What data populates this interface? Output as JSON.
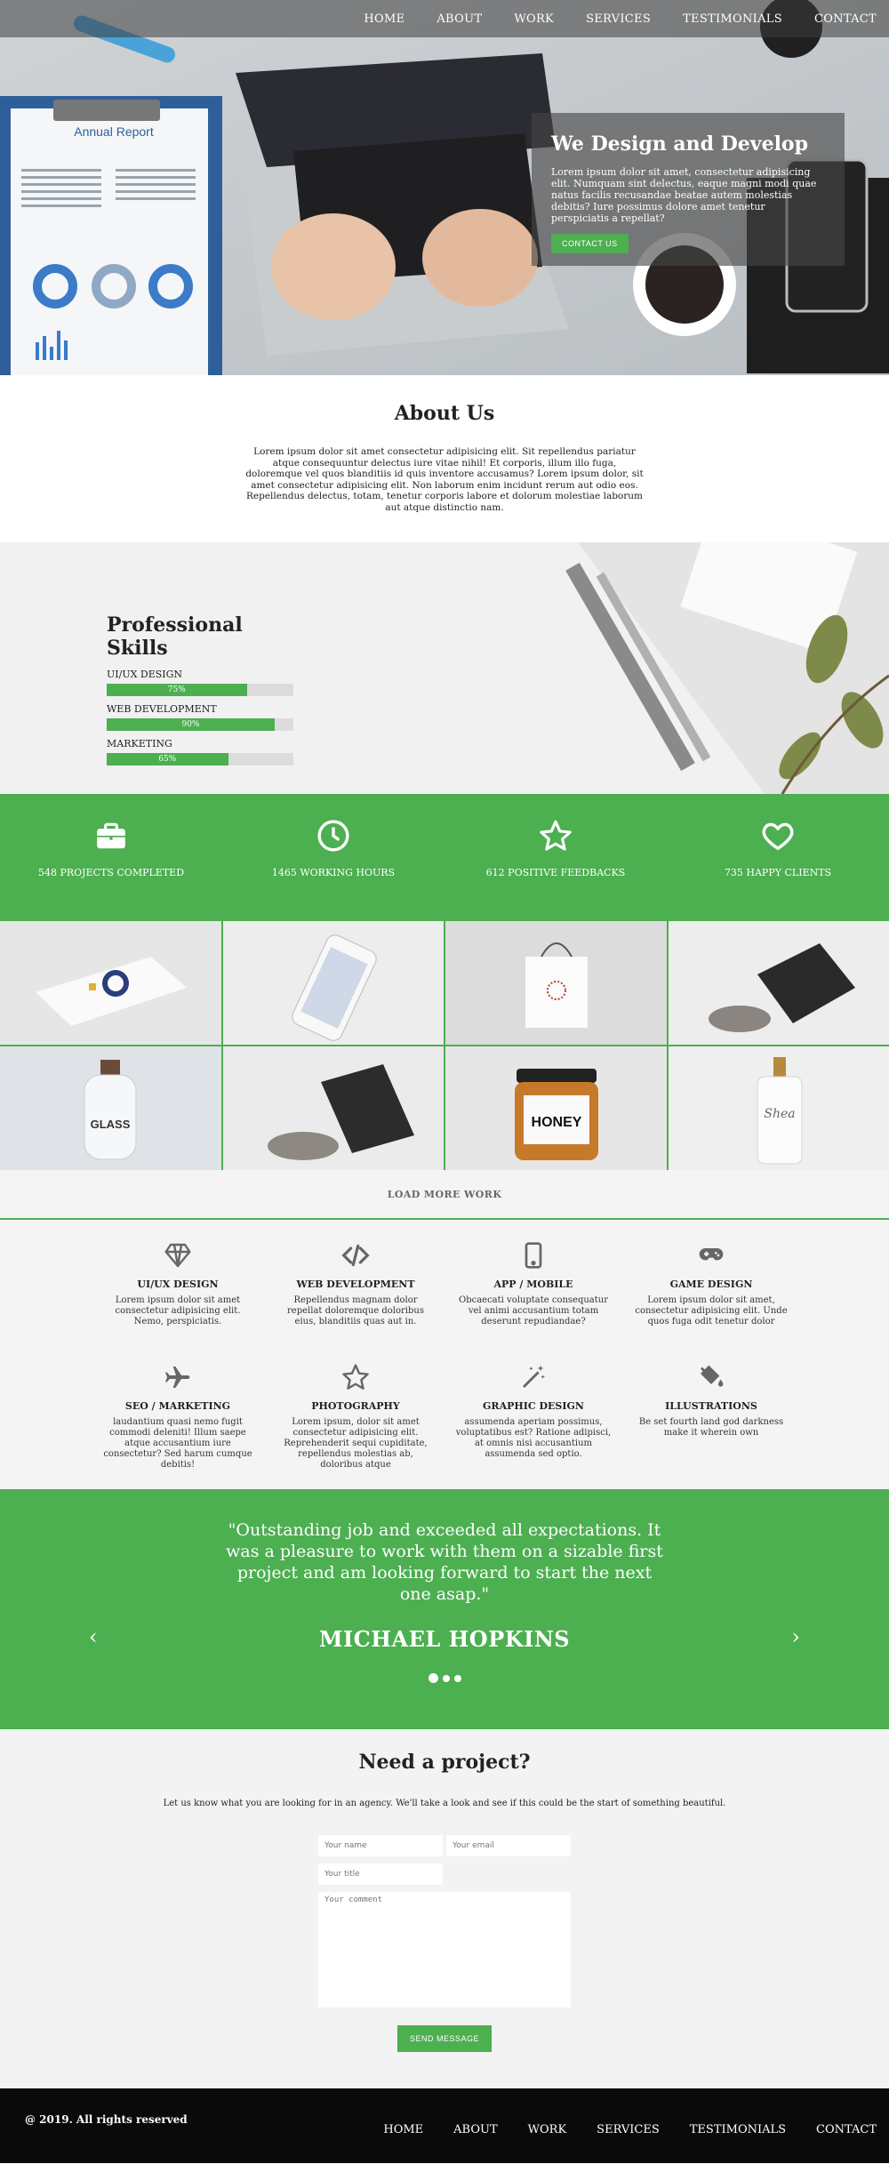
{
  "nav": {
    "items": [
      "HOME",
      "ABOUT",
      "WORK",
      "SERVICES",
      "TESTIMONIALS",
      "CONTACT"
    ]
  },
  "hero": {
    "title": "We Design and Develop",
    "text": "Lorem ipsum dolor sit amet, consectetur adipisicing elit. Numquam sint delectus, eaque magni modi quae natus facilis recusandae beatae autem molestias debitis? Iure possimus dolore amet tenetur perspiciatis a repellat?",
    "button": "CONTACT US",
    "report_title": "Annual Report"
  },
  "about": {
    "title": "About Us",
    "text": "Lorem ipsum dolor sit amet consectetur adipisicing elit. Sit repellendus pariatur atque consequuntur delectus iure vitae nihil! Et corporis, illum illo fuga, doloremque vel quos blanditiis id quis inventore accusamus? Lorem ipsum dolor, sit amet consectetur adipisicing elit. Non laborum enim incidunt rerum aut odio eos. Repellendus delectus, totam, tenetur corporis labore et dolorum molestiae laborum aut atque distinctio nam."
  },
  "skills": {
    "title": "Professional Skills",
    "items": [
      {
        "label": "UI/UX DESIGN",
        "value": 75,
        "text": "75%"
      },
      {
        "label": "WEB DEVELOPMENT",
        "value": 90,
        "text": "90%"
      },
      {
        "label": "MARKETING",
        "value": 65,
        "text": "65%"
      }
    ]
  },
  "stats": [
    {
      "icon": "briefcase-icon",
      "text": "548 PROJECTS COMPLETED"
    },
    {
      "icon": "clock-icon",
      "text": "1465 WORKING HOURS"
    },
    {
      "icon": "star-icon",
      "text": "612 POSITIVE FEEDBACKS"
    },
    {
      "icon": "heart-icon",
      "text": "735 HAPPY CLIENTS"
    }
  ],
  "portfolio": {
    "tiles": [
      {
        "name": "business-card-mockup",
        "bg": "#e4e4e4"
      },
      {
        "name": "phone-mockup",
        "bg": "#ececec"
      },
      {
        "name": "shopping-bag-mockup",
        "bg": "#dedede"
      },
      {
        "name": "dark-book-mockup",
        "bg": "#eeeeee"
      },
      {
        "name": "glass-bottle-mockup",
        "bg": "#dfe3e8",
        "label": "GLASS"
      },
      {
        "name": "dark-card-with-stone-mockup",
        "bg": "#ebebeb"
      },
      {
        "name": "honey-jar-mockup",
        "bg": "#e6e6e6",
        "label": "HONEY"
      },
      {
        "name": "soap-bottle-mockup",
        "bg": "#efefef",
        "label": "Shea"
      }
    ],
    "load_more": "LOAD MORE WORK"
  },
  "services": [
    {
      "icon": "diamond-icon",
      "title": "UI/UX DESIGN",
      "text": "Lorem ipsum dolor sit amet consectetur adipisicing elit. Nemo, perspiciatis."
    },
    {
      "icon": "code-icon",
      "title": "WEB DEVELOPMENT",
      "text": "Repellendus magnam dolor repellat doloremque doloribus eius, blanditiis quas aut in."
    },
    {
      "icon": "mobile-icon",
      "title": "APP / MOBILE",
      "text": "Obcaecati voluptate consequatur vel animi accusantium totam deserunt repudiandae?"
    },
    {
      "icon": "gamepad-icon",
      "title": "GAME DESIGN",
      "text": "Lorem ipsum dolor sit amet, consectetur adipisicing elit. Unde quos fuga odit tenetur dolor"
    },
    {
      "icon": "plane-icon",
      "title": "SEO / MARKETING",
      "text": "laudantium quasi nemo fugit commodi deleniti! Illum saepe atque accusantium iure consectetur? Sed harum cumque debitis!"
    },
    {
      "icon": "star-outline-icon",
      "title": "PHOTOGRAPHY",
      "text": "Lorem ipsum, dolor sit amet consectetur adipisicing elit. Reprehenderit sequi cupiditate, repellendus molestias ab, doloribus atque"
    },
    {
      "icon": "magic-wand-icon",
      "title": "GRAPHIC DESIGN",
      "text": "assumenda aperiam possimus, voluptatibus est? Ratione adipisci, at omnis nisi accusantium assumenda sed optio."
    },
    {
      "icon": "paint-bucket-icon",
      "title": "ILLUSTRATIONS",
      "text": "Be set fourth land god darkness make it wherein own"
    }
  ],
  "testimonial": {
    "quote": "\"Outstanding job and exceeded all expectations. It was a pleasure to work with them on a sizable first project and am looking forward to start the next one asap.\"",
    "name": "MICHAEL HOPKINS",
    "prev": "‹",
    "next": "›"
  },
  "contact": {
    "title": "Need a project?",
    "intro": "Let us know what you are looking for in an agency. We'll take a look and see if this could be the start of something beautiful.",
    "name_placeholder": "Your name",
    "email_placeholder": "Your email",
    "title_placeholder": "Your title",
    "comment_placeholder": "Your comment",
    "button": "SEND MESSAGE"
  },
  "footer": {
    "copyright": "@ 2019. All rights reserved",
    "nav": [
      "HOME",
      "ABOUT",
      "WORK",
      "SERVICES",
      "TESTIMONIALS",
      "CONTACT"
    ]
  },
  "colors": {
    "accent": "#4caf50",
    "footer": "#0a0a0a"
  }
}
